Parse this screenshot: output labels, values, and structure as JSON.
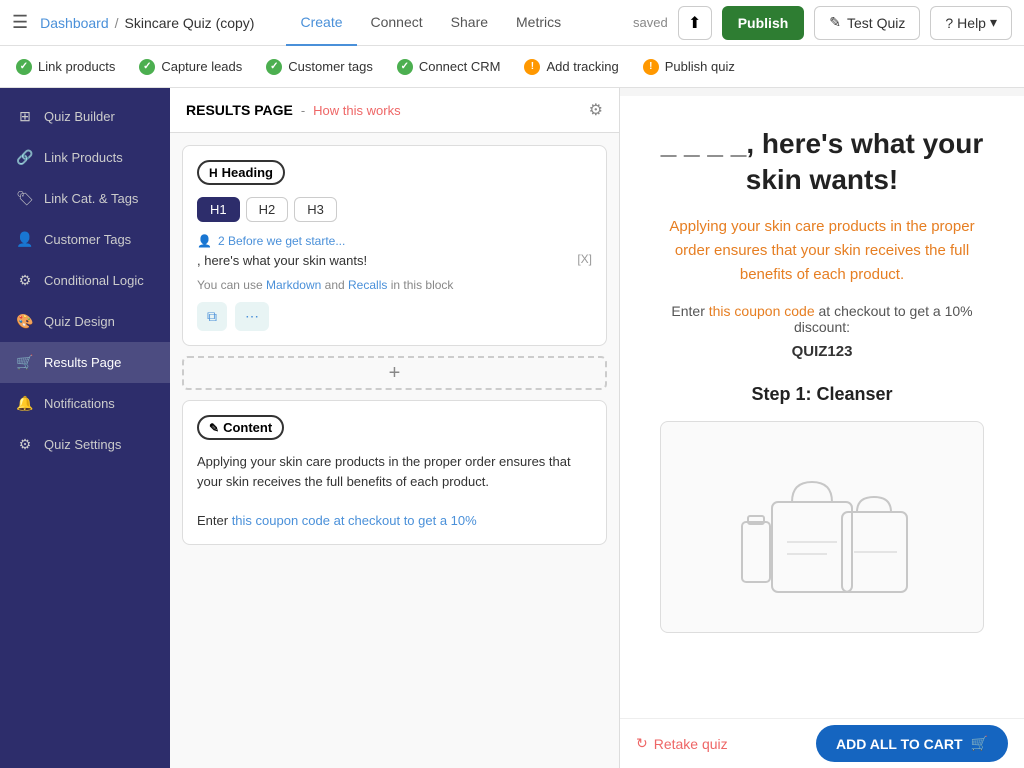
{
  "topNav": {
    "hamburger": "☰",
    "breadcrumb": {
      "dashboard": "Dashboard",
      "separator": "/",
      "current": "Skincare Quiz (copy)"
    },
    "tabs": [
      {
        "label": "Create",
        "active": true
      },
      {
        "label": "Connect",
        "active": false
      },
      {
        "label": "Share",
        "active": false
      },
      {
        "label": "Metrics",
        "active": false
      }
    ],
    "saved_label": "saved",
    "btn_export": "⬆",
    "btn_publish": "Publish",
    "btn_test": "✎ Test Quiz",
    "btn_help": "? Help ▾"
  },
  "stepBar": {
    "steps": [
      {
        "label": "Link products",
        "status": "green"
      },
      {
        "label": "Capture leads",
        "status": "green"
      },
      {
        "label": "Customer tags",
        "status": "green"
      },
      {
        "label": "Connect CRM",
        "status": "green"
      },
      {
        "label": "Add tracking",
        "status": "orange"
      },
      {
        "label": "Publish quiz",
        "status": "orange"
      }
    ]
  },
  "sidebar": {
    "items": [
      {
        "icon": "⊞",
        "label": "Quiz Builder",
        "active": false
      },
      {
        "icon": "🔗",
        "label": "Link Products",
        "active": false
      },
      {
        "icon": "🏷",
        "label": "Link Cat. & Tags",
        "active": false
      },
      {
        "icon": "👤",
        "label": "Customer Tags",
        "active": false
      },
      {
        "icon": "⚙",
        "label": "Conditional Logic",
        "active": false
      },
      {
        "icon": "🎨",
        "label": "Quiz Design",
        "active": false
      },
      {
        "icon": "🛒",
        "label": "Results Page",
        "active": true
      },
      {
        "icon": "🔔",
        "label": "Notifications",
        "active": false
      },
      {
        "icon": "⚙",
        "label": "Quiz Settings",
        "active": false
      }
    ]
  },
  "editor": {
    "title": "RESULTS PAGE",
    "separator": "-",
    "how_link": "How this works",
    "gear_icon": "⚙",
    "heading_block": {
      "badge_label": "Heading",
      "badge_icon": "H",
      "buttons": [
        {
          "label": "H1",
          "active": true
        },
        {
          "label": "H2",
          "active": false
        },
        {
          "label": "H3",
          "active": false
        }
      ],
      "user_line": "2   Before we get starte...",
      "heading_text": ", here's what your skin wants!",
      "remove": "[X]",
      "markdown_text": "You can use ",
      "markdown_link": "Markdown",
      "markdown_and": " and ",
      "recalls_link": "Recalls",
      "markdown_suffix": " in this block",
      "action_copy": "⧉",
      "action_more": "⋯"
    },
    "add_block_label": "+",
    "content_block": {
      "badge_label": "Content",
      "badge_icon": "✎",
      "text_lines": [
        "Applying your skin care products in the proper order ensures that your skin receives the full benefits of each product.",
        "",
        "Enter this coupon code at checkout to get a 10%"
      ]
    }
  },
  "preview": {
    "title": "_ _ _ _, here's what your skin wants!",
    "subtitle": "Applying your skin care products in the proper order ensures\nthat your skin receives the full benefits of each product.",
    "coupon_text": "Enter this coupon code at checkout to get a 10% discount:",
    "coupon_code": "QUIZ123",
    "step_label": "Step 1: Cleanser",
    "retake_label": "Retake quiz",
    "add_cart_label": "ADD ALL TO CART",
    "cart_icon": "🛒"
  }
}
